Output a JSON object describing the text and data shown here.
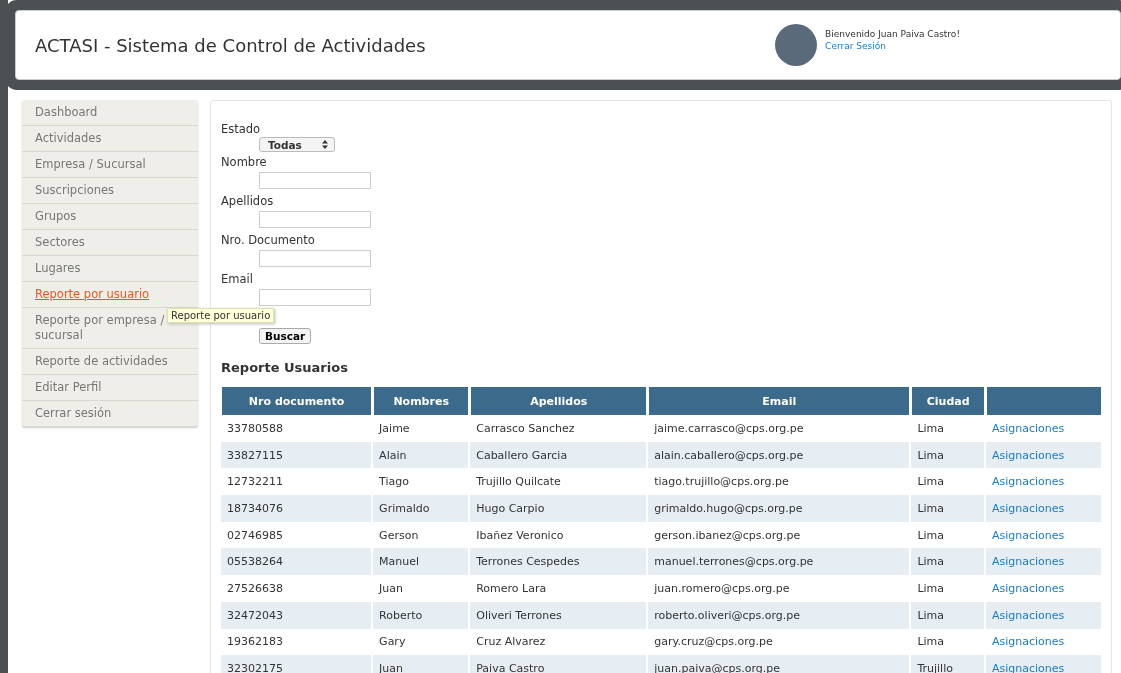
{
  "header": {
    "title": "ACTASI - Sistema de Control de Actividades",
    "welcome": "Bienvenido Juan Paiva Castro!",
    "logout": "Cerrar Sesión"
  },
  "sidebar": {
    "items": [
      {
        "label": "Dashboard",
        "selected": false
      },
      {
        "label": "Actividades",
        "selected": false
      },
      {
        "label": "Empresa / Sucursal",
        "selected": false
      },
      {
        "label": "Suscripciones",
        "selected": false
      },
      {
        "label": "Grupos",
        "selected": false
      },
      {
        "label": "Sectores",
        "selected": false
      },
      {
        "label": "Lugares",
        "selected": false
      },
      {
        "label": "Reporte por usuario",
        "selected": true
      },
      {
        "label": "Reporte por empresa / sucursal",
        "selected": false
      },
      {
        "label": "Reporte de actividades",
        "selected": false
      },
      {
        "label": "Editar Perfil",
        "selected": false
      },
      {
        "label": "Cerrar sesión",
        "selected": false
      }
    ],
    "tooltip": "Reporte por usuario"
  },
  "filters": [
    {
      "kind": "select",
      "label": "Estado",
      "value": "Todas"
    },
    {
      "kind": "text",
      "label": "Nombre"
    },
    {
      "kind": "text",
      "label": "Apellidos"
    },
    {
      "kind": "text",
      "label": "Nro. Documento"
    },
    {
      "kind": "text",
      "label": "Email"
    }
  ],
  "search_button": "Buscar",
  "report": {
    "title": "Reporte Usuarios",
    "columns": [
      "Nro documento",
      "Nombres",
      "Apellidos",
      "Email",
      "Ciudad"
    ],
    "rows": [
      {
        "doc": "33780588",
        "first": "Jaime",
        "last": "Carrasco Sanchez",
        "email": "jaime.carrasco@cps.org.pe",
        "city": "Lima",
        "link": "Asignaciones"
      },
      {
        "doc": "33827115",
        "first": "Alain",
        "last": "Caballero Garcia",
        "email": "alain.caballero@cps.org.pe",
        "city": "Lima",
        "link": "Asignaciones"
      },
      {
        "doc": "12732211",
        "first": "Tiago",
        "last": "Trujillo Quilcate",
        "email": "tiago.trujillo@cps.org.pe",
        "city": "Lima",
        "link": "Asignaciones"
      },
      {
        "doc": "18734076",
        "first": "Grimaldo",
        "last": "Hugo Carpio",
        "email": "grimaldo.hugo@cps.org.pe",
        "city": "Lima",
        "link": "Asignaciones"
      },
      {
        "doc": "02746985",
        "first": "Gerson",
        "last": "Ibañez Veronico",
        "email": "gerson.ibanez@cps.org.pe",
        "city": "Lima",
        "link": "Asignaciones"
      },
      {
        "doc": "05538264",
        "first": "Manuel",
        "last": "Terrones Cespedes",
        "email": "manuel.terrones@cps.org.pe",
        "city": "Lima",
        "link": "Asignaciones"
      },
      {
        "doc": "27526638",
        "first": "Juan",
        "last": "Romero Lara",
        "email": "juan.romero@cps.org.pe",
        "city": "Lima",
        "link": "Asignaciones"
      },
      {
        "doc": "32472043",
        "first": "Roberto",
        "last": "Oliveri Terrones",
        "email": "roberto.oliveri@cps.org.pe",
        "city": "Lima",
        "link": "Asignaciones"
      },
      {
        "doc": "19362183",
        "first": "Gary",
        "last": "Cruz Alvarez",
        "email": "gary.cruz@cps.org.pe",
        "city": "Lima",
        "link": "Asignaciones"
      },
      {
        "doc": "32302175",
        "first": "Juan",
        "last": "Paiva Castro",
        "email": "juan.paiva@cps.org.pe",
        "city": "Trujillo",
        "link": "Asignaciones"
      }
    ]
  }
}
